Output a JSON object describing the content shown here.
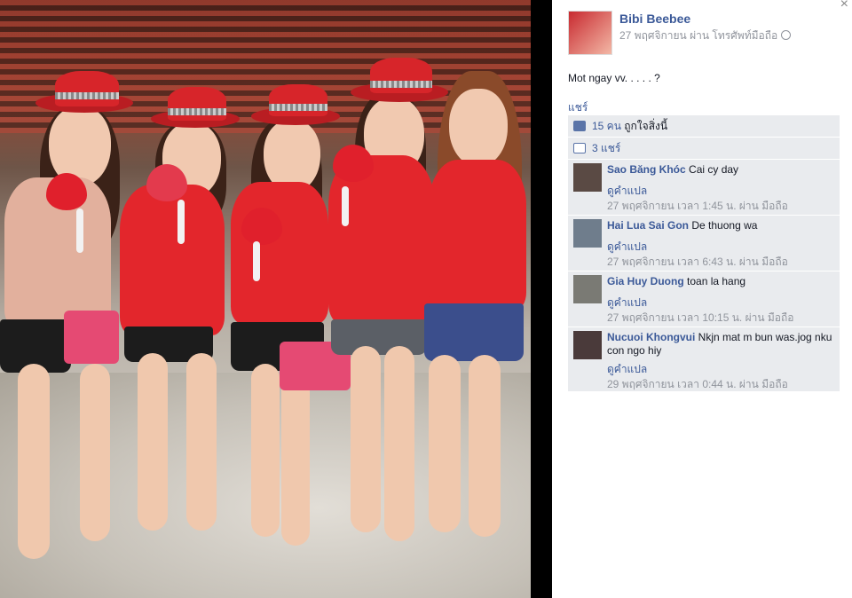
{
  "post": {
    "author": "Bibi Beebee",
    "meta": "27 พฤศจิกายน ผ่าน โทรศัพท์มือถือ",
    "caption": "Mot ngay vv. . . . . ?",
    "share_link": "แชร์",
    "likes_count": "15 คน",
    "likes_text": "ถูกใจสิ่งนี้",
    "shares_text": "3 แชร์",
    "close": "×"
  },
  "comments": [
    {
      "name": "Sao Băng Khóc",
      "text": "Cai cy day",
      "translate": "ดูคำแปล",
      "time": "27 พฤศจิกายน เวลา 1:45 น. ผ่าน มือถือ"
    },
    {
      "name": "Hai Lua Sai Gon",
      "text": "De thuong wa",
      "translate": "ดูคำแปล",
      "time": "27 พฤศจิกายน เวลา 6:43 น. ผ่าน มือถือ"
    },
    {
      "name": "Gia Huy Duong",
      "text": "toan la hang",
      "translate": "ดูคำแปล",
      "time": "27 พฤศจิกายน เวลา 10:15 น. ผ่าน มือถือ"
    },
    {
      "name": "Nucuoi Khongvui",
      "text": "Nkjn mat m bun was.jog nku con ngo hiy",
      "translate": "ดูคำแปล",
      "time": "29 พฤศจิกายน เวลา 0:44 น. ผ่าน มือถือ"
    }
  ],
  "colors": {
    "link": "#3b5998",
    "ufi_bg": "#e9ebee",
    "shirt": "#e3262c"
  },
  "icons": {
    "like": "thumbs-up-icon",
    "share": "share-icon",
    "privacy": "globe-icon",
    "close": "close-icon"
  }
}
